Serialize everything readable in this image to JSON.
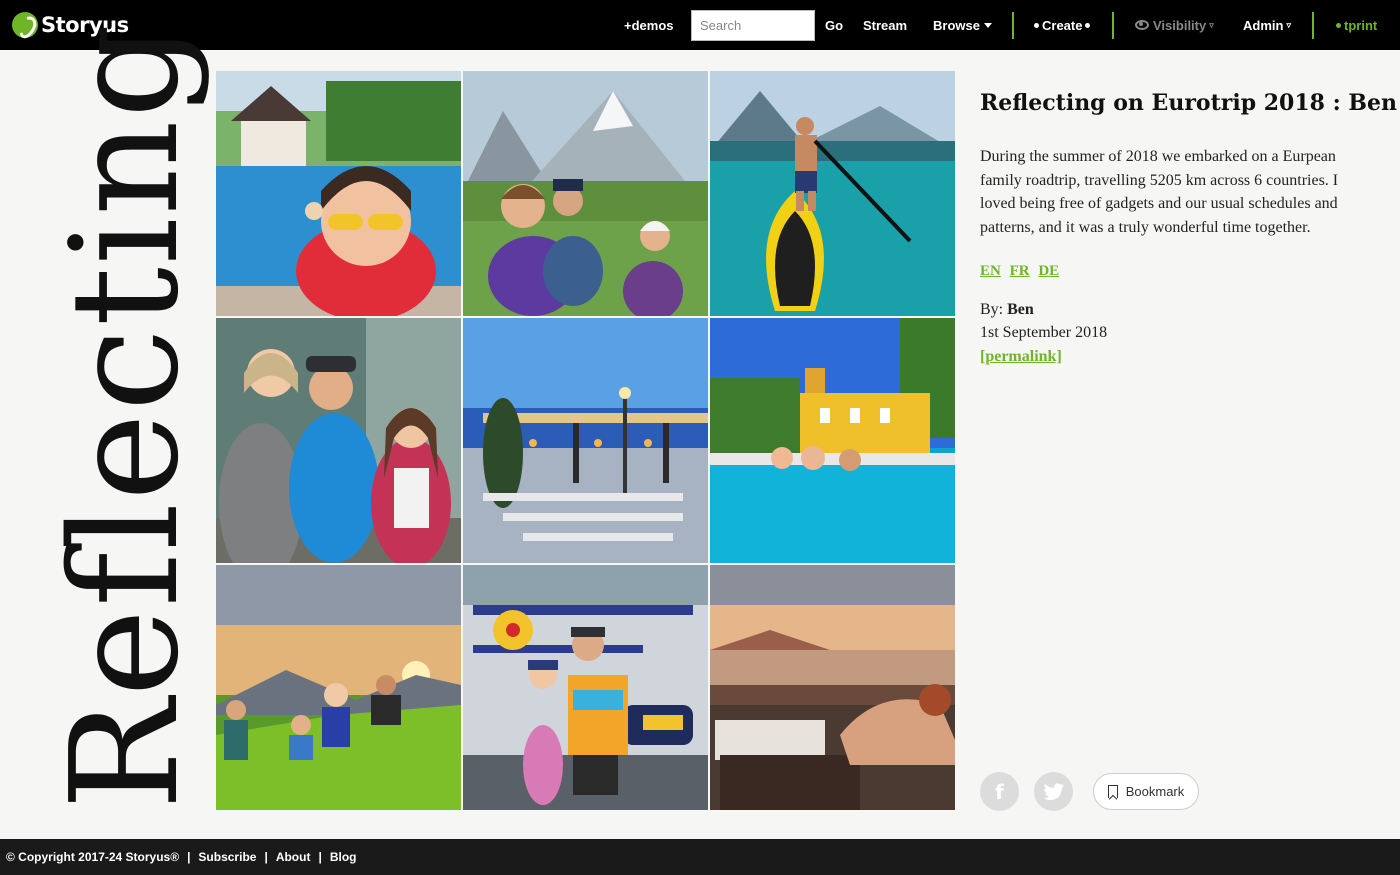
{
  "header": {
    "logo_text": "Storyus",
    "demos_label": "+demos",
    "search_placeholder": "Search",
    "go_label": "Go",
    "stream_label": "Stream",
    "browse_label": "Browse",
    "create_label": "Create",
    "visibility_label": "Visibility",
    "admin_label": "Admin",
    "user_label": "tprint"
  },
  "page": {
    "vertical_title": "Reflecting"
  },
  "photos": [
    {
      "subject": "girl with goggles in swimming pool"
    },
    {
      "subject": "three kids sitting on mountain meadow"
    },
    {
      "subject": "boy paddleboarding on lake"
    },
    {
      "subject": "mother and two kids in cave"
    },
    {
      "subject": "lakeside restaurant terrace at dusk"
    },
    {
      "subject": "family swimming in pool by villa"
    },
    {
      "subject": "family on hillside at sunset"
    },
    {
      "subject": "two kids at aircraft museum"
    },
    {
      "subject": "balcony view over town at sunset"
    }
  ],
  "story": {
    "title": "Reflecting on Eurotrip 2018 : Ben",
    "description": "During the summer of 2018 we embarked on a Eurpean family roadtrip, travelling 5205 km across 6 countries. I loved being free of gadgets and our usual schedules and patterns, and it was a truly wonderful time together.",
    "languages": [
      "EN",
      "FR",
      "DE"
    ],
    "by_label": "By:",
    "author": "Ben",
    "date": "1st September 2018",
    "permalink_label": "[permalink]"
  },
  "actions": {
    "bookmark_label": "Bookmark",
    "facebook_icon": "f",
    "twitter_icon": "t"
  },
  "footer": {
    "copyright": "© Copyright 2017-24 Storyus®",
    "links": [
      "Subscribe",
      "About",
      "Blog"
    ]
  },
  "colors": {
    "brand_green": "#6fb528",
    "nav_bg": "#000000",
    "footer_bg": "#1a1a1a"
  }
}
